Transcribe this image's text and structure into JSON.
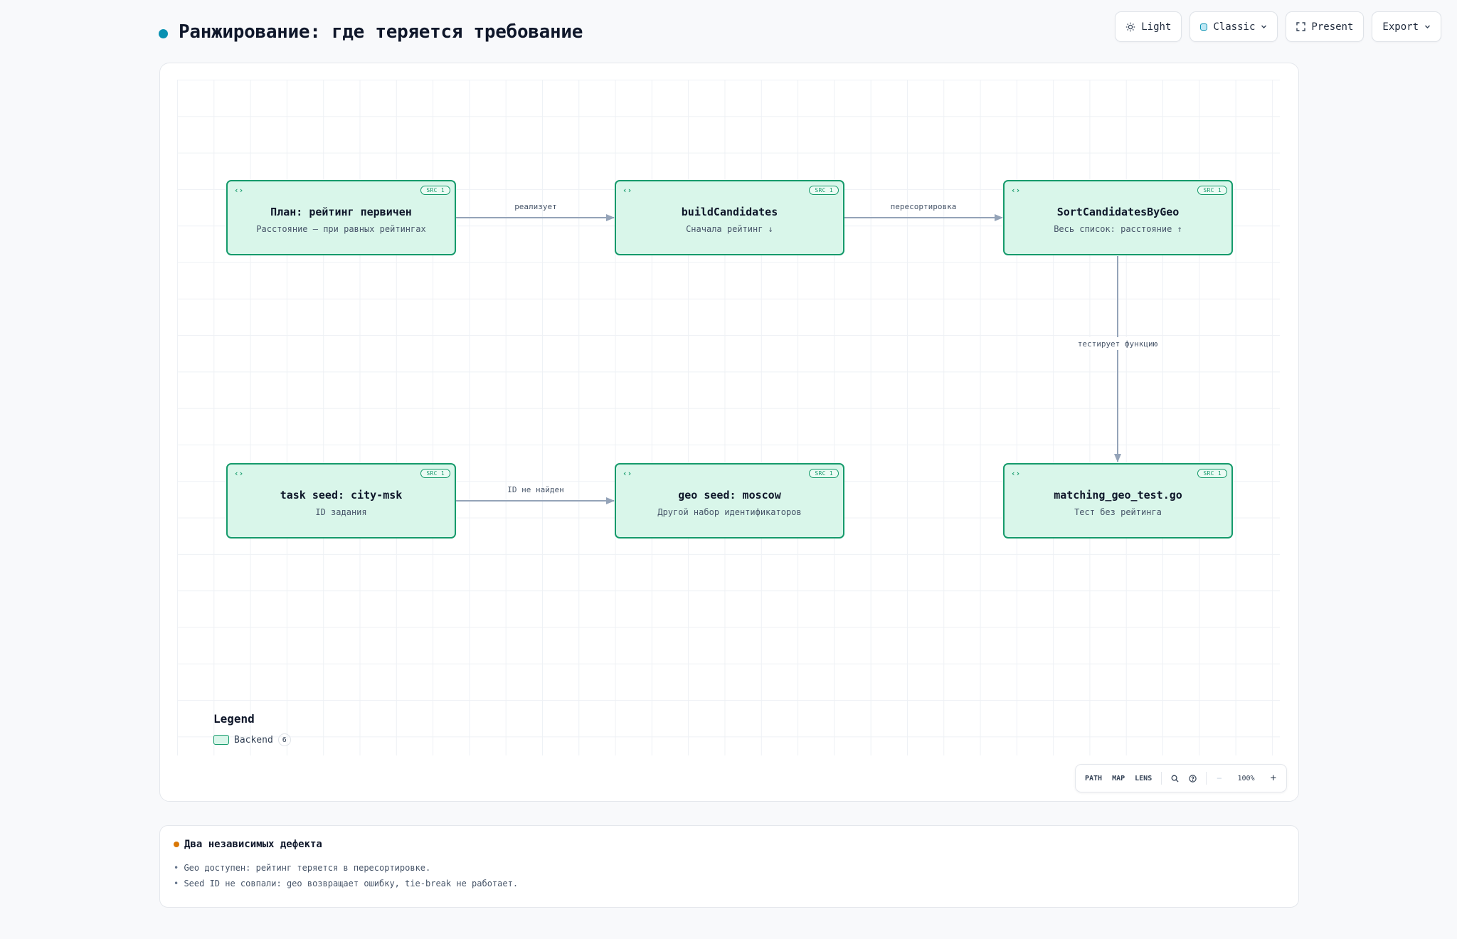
{
  "header": {
    "title": "Ранжирование: где теряется требование",
    "accent_color": "#0891b2"
  },
  "toolbar": {
    "theme_label": "Light",
    "theme_icon": "sun-icon",
    "style_label": "Classic",
    "present_label": "Present",
    "present_icon": "fullscreen-icon",
    "export_label": "Export"
  },
  "diagram": {
    "node_style": {
      "fill": "#d9f6ea",
      "border": "#159a6b"
    },
    "nodes": [
      {
        "id": "plan",
        "code_icon": "‹›",
        "src_badge": "SRC 1",
        "title": "План: рейтинг первичен",
        "subtitle": "Расстояние — при равных рейтингах"
      },
      {
        "id": "build",
        "code_icon": "‹›",
        "src_badge": "SRC 1",
        "title": "buildCandidates",
        "subtitle": "Сначала рейтинг ↓"
      },
      {
        "id": "sort",
        "code_icon": "‹›",
        "src_badge": "SRC 1",
        "title": "SortCandidatesByGeo",
        "subtitle": "Весь список: расстояние ↑"
      },
      {
        "id": "task",
        "code_icon": "‹›",
        "src_badge": "SRC 1",
        "title": "task seed: city-msk",
        "subtitle": "ID задания"
      },
      {
        "id": "geo",
        "code_icon": "‹›",
        "src_badge": "SRC 1",
        "title": "geo seed: moscow",
        "subtitle": "Другой набор идентификаторов"
      },
      {
        "id": "test",
        "code_icon": "‹›",
        "src_badge": "SRC 1",
        "title": "matching_geo_test.go",
        "subtitle": "Тест без рейтинга"
      }
    ],
    "edges": [
      {
        "from": "plan",
        "to": "build",
        "label": "реализует"
      },
      {
        "from": "build",
        "to": "sort",
        "label": "пересортировка"
      },
      {
        "from": "sort",
        "to": "test",
        "label": "тестирует функцию"
      },
      {
        "from": "task",
        "to": "geo",
        "label": "ID не найден"
      }
    ],
    "edge_color": "#94a3b8"
  },
  "legend": {
    "title": "Legend",
    "items": [
      {
        "label": "Backend",
        "count": "6"
      }
    ]
  },
  "controls": {
    "path_label": "PATH",
    "map_label": "MAP",
    "lens_label": "LENS",
    "zoom_level": "100%",
    "minus_label": "−",
    "plus_label": "+"
  },
  "notes": {
    "accent_color": "#d97706",
    "title": "Два независимых дефекта",
    "items": [
      "Geo доступен: рейтинг теряется в пересортировке.",
      "Seed ID не совпали: geo возвращает ошибку, tie-break не работает."
    ]
  }
}
